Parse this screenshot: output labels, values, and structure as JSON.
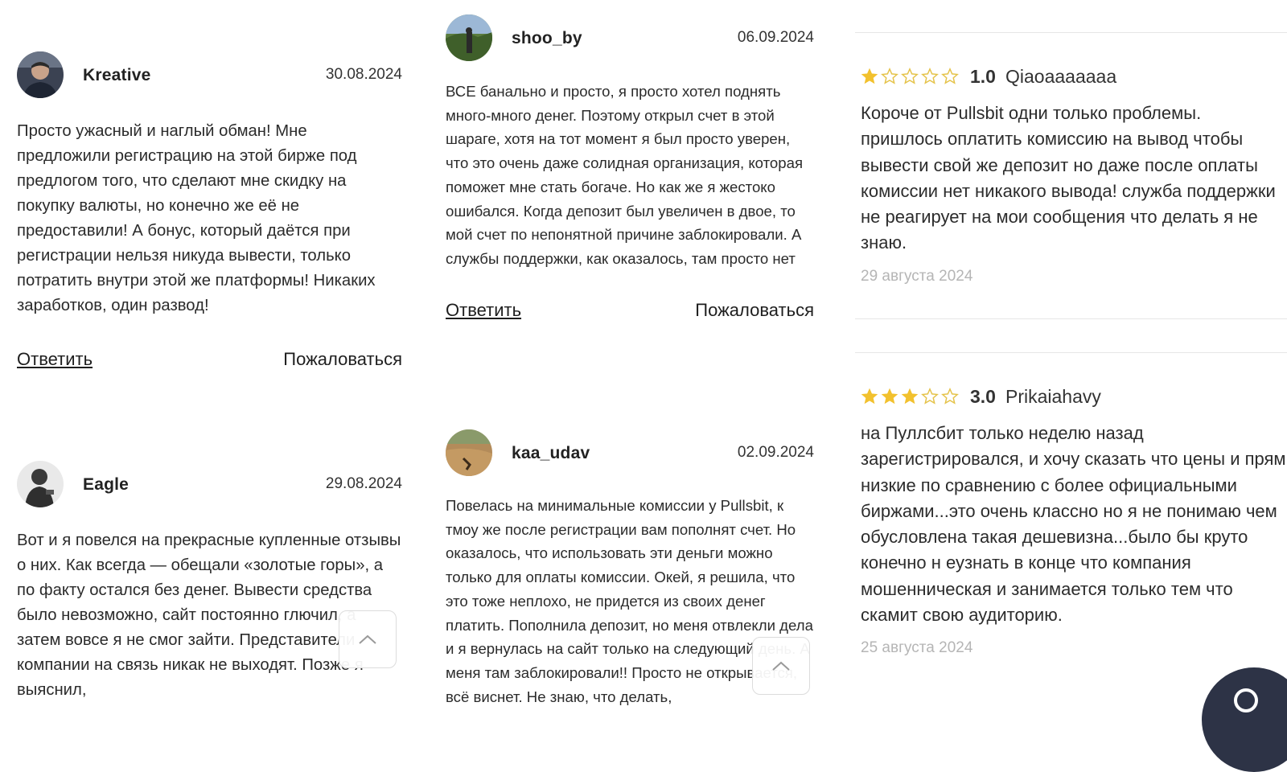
{
  "left_column": {
    "reviews": [
      {
        "author": "Kreative",
        "date": "30.08.2024",
        "text": "Просто ужасный и наглый обман! Мне предложили регистрацию на этой бирже под предлогом того, что сделают мне скидку на покупку валюты, но конечно же её не предоставили! А бонус, который даётся при регистрации нельзя никуда вывести, только потратить внутри этой же платформы! Никаких заработков, один развод!",
        "reply_label": "Ответить",
        "complain_label": "Пожаловаться"
      },
      {
        "author": "Eagle",
        "date": "29.08.2024",
        "text": "Вот и я повелся на прекрасные купленные отзывы о них. Как всегда — обещали «золотые горы», а по факту остался без денег. Вывести средства было невозможно, сайт постоянно глючил, а затем вовсе я не смог зайти. Представители компании на связь никак не выходят. Позже я выяснил,"
      }
    ]
  },
  "middle_column": {
    "reviews": [
      {
        "author": "shoo_by",
        "date": "06.09.2024",
        "text": "ВСЕ банально и просто, я просто хотел поднять много-много денег. Поэтому открыл счет в этой шараге, хотя на тот момент я был просто уверен, что это очень даже солидная организация, которая поможет мне стать богаче. Но как же я жестоко ошибался. Когда депозит был увеличен в двое, то мой счет по непонятной причине заблокировали. А службы поддержки, как оказалось, там просто нет",
        "reply_label": "Ответить",
        "complain_label": "Пожаловаться"
      },
      {
        "author": "kaa_udav",
        "date": "02.09.2024",
        "text": "Повелась на минимальные комиссии у Pullsbit, к тмоу же после регистрации вам пополнят счет. Но оказалось, что использовать эти деньги можно только для оплаты комиссии. Окей, я решила, что это тоже неплохо, не придется из своих денег платить. Пополнила депозит, но меня отвлекли дела и я вернулась на сайт только на следующий день. А меня там заблокировали!! Просто не открывается, всё виснет. Не знаю, что делать,"
      }
    ]
  },
  "right_column": {
    "reviews": [
      {
        "rating": 1,
        "score": "1.0",
        "name": "Qiaoaaaaaaa",
        "text": "Короче от Pullsbit одни только проблемы. пришлось оплатить комиссию на вывод чтобы вывести свой же депозит но даже после оплаты комиссии нет никакого вывода! служба поддержки не реагирует на мои сообщения что делать я не знаю.",
        "date": "29 августа 2024"
      },
      {
        "rating": 3,
        "score": "3.0",
        "name": "Prikaiahavy",
        "text": "на Пуллсбит только неделю назад зарегистрировался, и хочу сказать что цены и прям низкие по сравнению с более официальными биржами...это очень классно но я не понимаю чем обусловлена такая дешевизна...было бы круто конечно н еузнать в конце что компания мошенническая и занимается только тем что скамит свою аудиторию.",
        "date": "25 августа 2024"
      }
    ]
  },
  "colors": {
    "star_filled": "#F2C12E",
    "star_empty": "#E5C34A",
    "text": "#2B2B2B",
    "muted_date": "#B5B5B5",
    "chat_bubble": "#2D3346"
  },
  "icons": {
    "scroll_top": "chevron-up-icon",
    "chat": "chat-icon",
    "star": "star-icon"
  }
}
